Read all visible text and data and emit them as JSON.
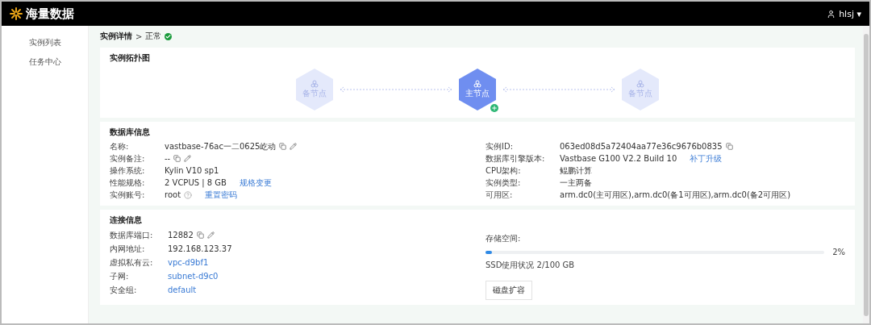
{
  "header": {
    "logo": "海量数据",
    "user": "hlsj",
    "user_caret": "▾"
  },
  "sidebar": {
    "items": [
      {
        "label": "实例列表",
        "selected": false
      },
      {
        "label": "任务中心",
        "selected": false
      }
    ]
  },
  "breadcrumb": {
    "page": "实例详情",
    "separator": ">",
    "status": "正常"
  },
  "topology": {
    "title": "实例拓扑图",
    "nodes": [
      {
        "label": "备节点",
        "selected": false,
        "added": false
      },
      {
        "label": "主节点",
        "selected": true,
        "added": true
      },
      {
        "label": "备节点",
        "selected": false,
        "added": false
      }
    ]
  },
  "db_info": {
    "title": "数据库信息",
    "columns": [
      [
        {
          "label": "名称:",
          "value": "vastbase-76ac一二0625屹动",
          "kind": "text",
          "copyable": true,
          "editable": true
        },
        {
          "label": "实例备注:",
          "value": "--",
          "kind": "text",
          "copyable": true,
          "editable": true
        },
        {
          "label": "操作系统:",
          "value": "Kylin V10 sp1",
          "kind": "text"
        },
        {
          "label": "性能规格:",
          "value": "2 VCPUS | 8 GB",
          "kind": "text",
          "action": "规格变更"
        },
        {
          "label": "实例账号:",
          "value": "root",
          "kind": "text",
          "help": true,
          "action": "重置密码"
        }
      ],
      [
        {
          "label": "实例ID:",
          "value": "063ed08d5a72404aa77e36c9676b0835",
          "kind": "text",
          "copyable": true
        },
        {
          "label": "数据库引擎版本:",
          "value": "Vastbase G100 V2.2 Build 10",
          "kind": "text",
          "action": "补丁升级"
        },
        {
          "label": "CPU架构:",
          "value": "鲲鹏计算",
          "kind": "text"
        },
        {
          "label": "实例类型:",
          "value": "一主两备",
          "kind": "text"
        },
        {
          "label": "可用区:",
          "value": "arm.dc0(主可用区),arm.dc0(备1可用区),arm.dc0(备2可用区)",
          "kind": "text"
        }
      ]
    ]
  },
  "connection": {
    "title": "连接信息",
    "fields": [
      {
        "label": "数据库端口:",
        "value": "12882",
        "kind": "text",
        "copyable": true,
        "editable": true
      },
      {
        "label": "内网地址:",
        "value": "192.168.123.37",
        "kind": "text"
      },
      {
        "label": "虚拟私有云:",
        "value": "vpc-d9bf1",
        "kind": "link"
      },
      {
        "label": "子网:",
        "value": "subnet-d9c0",
        "kind": "link"
      },
      {
        "label": "安全组:",
        "value": "default",
        "kind": "link"
      }
    ],
    "storage": {
      "label": "存储空间:",
      "level": 0.02,
      "percent": "2%",
      "usage": "SSD使用状况 2/100 GB",
      "button": "磁盘扩容"
    }
  }
}
